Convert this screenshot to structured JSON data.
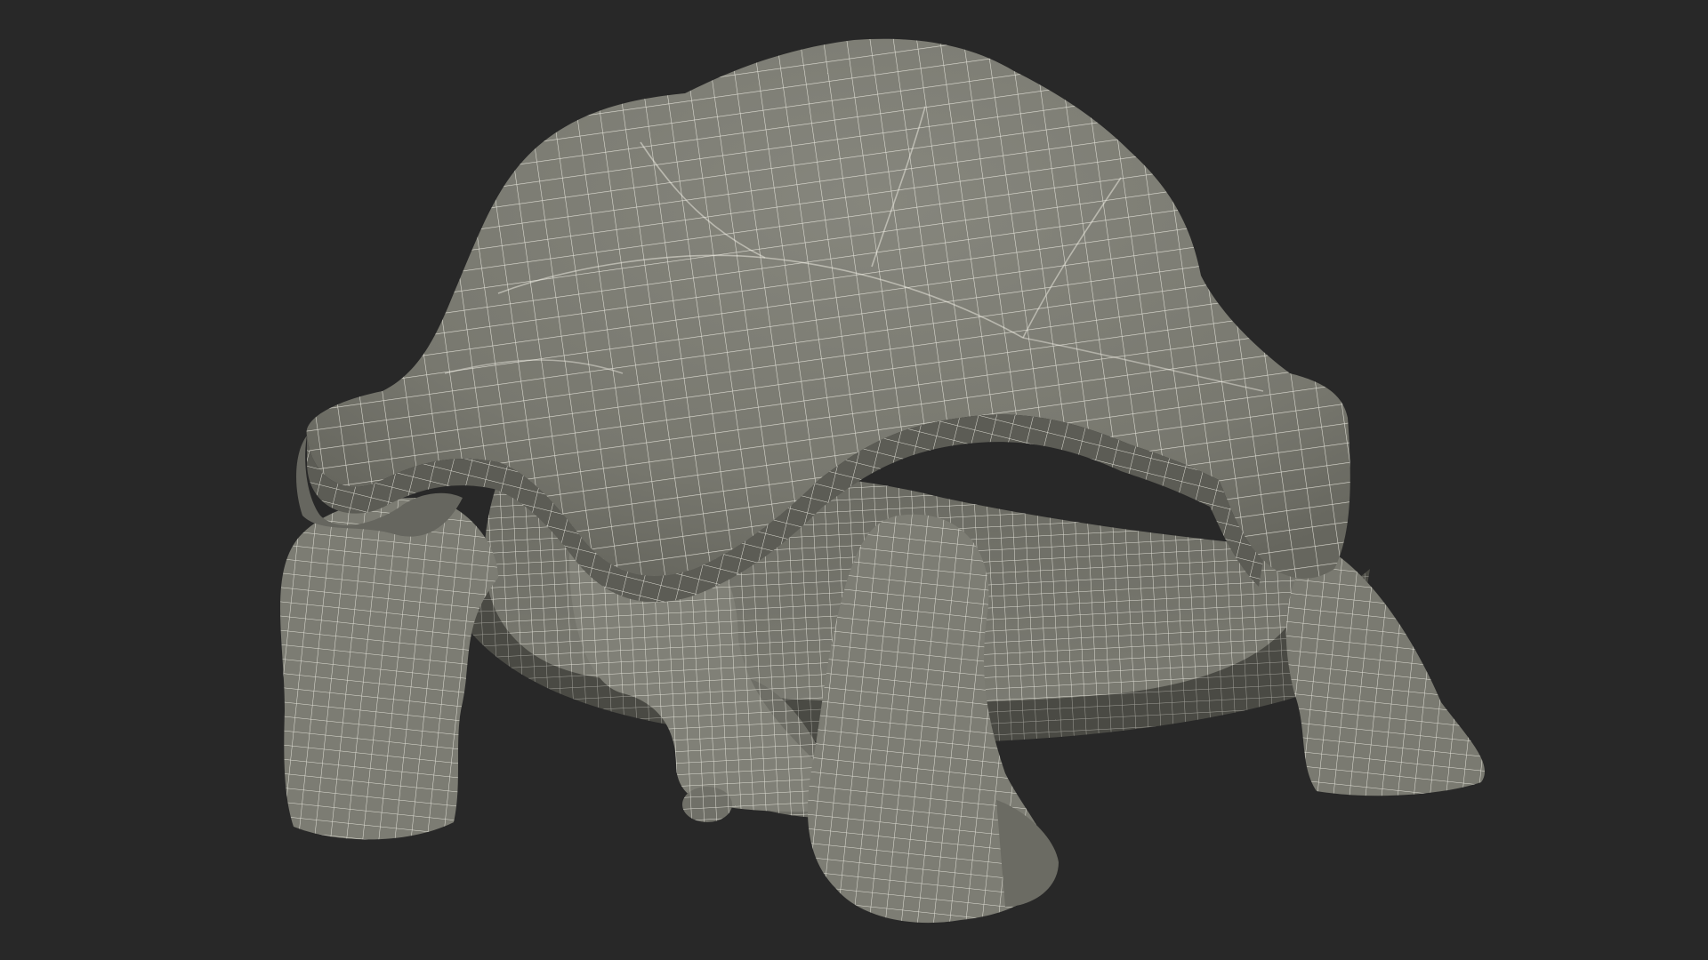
{
  "scene": {
    "subject": "tortoise-wireframe",
    "render_mode": "wireframe-on-shaded",
    "colors": {
      "background": "#282828",
      "surface_light": "#83837a",
      "surface_mid": "#76766d",
      "surface_dark": "#5a5a53",
      "shadow": "#45453f",
      "wire": "#f1f0e6"
    }
  }
}
